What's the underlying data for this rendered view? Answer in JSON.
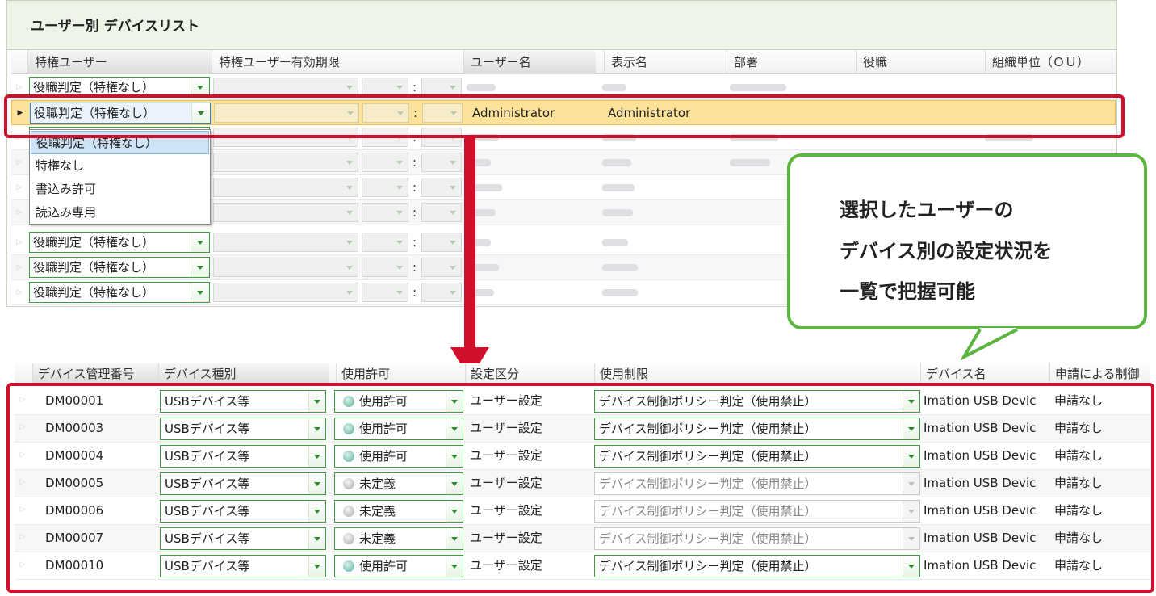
{
  "top_grid": {
    "title": "ユーザー別 デバイスリスト",
    "columns": [
      "特権ユーザー",
      "特権ユーザー有効期限",
      "ユーザー名",
      "表示名",
      "部署",
      "役職",
      "組織単位（ＯＵ）"
    ],
    "combo_value": "役職判定（特権なし）",
    "colon": ":",
    "selected_row": {
      "user_name": "Administrator",
      "display_name": "Administrator"
    },
    "dropdown_options": [
      "役職判定（特権なし）",
      "特権なし",
      "書込み許可",
      "読込み専用"
    ]
  },
  "callout": {
    "lines": [
      "選択したユーザーの",
      "デバイス別の設定状況を",
      "一覧で把握可能"
    ]
  },
  "bottom_grid": {
    "columns": [
      "デバイス管理番号",
      "デバイス種別",
      "使用許可",
      "設定区分",
      "使用制限",
      "デバイス名",
      "申請による制御"
    ],
    "rows": [
      {
        "id": "DM00001",
        "type": "USBデバイス等",
        "permit": "使用許可",
        "permit_on": true,
        "setting": "ユーザー設定",
        "limit": "デバイス制御ポリシー判定（使用禁止）",
        "limit_enabled": true,
        "name": "Imation USB Devic",
        "request": "申請なし"
      },
      {
        "id": "DM00003",
        "type": "USBデバイス等",
        "permit": "使用許可",
        "permit_on": true,
        "setting": "ユーザー設定",
        "limit": "デバイス制御ポリシー判定（使用禁止）",
        "limit_enabled": true,
        "name": "Imation USB Devic",
        "request": "申請なし"
      },
      {
        "id": "DM00004",
        "type": "USBデバイス等",
        "permit": "使用許可",
        "permit_on": true,
        "setting": "ユーザー設定",
        "limit": "デバイス制御ポリシー判定（使用禁止）",
        "limit_enabled": true,
        "name": "Imation USB Devic",
        "request": "申請なし"
      },
      {
        "id": "DM00005",
        "type": "USBデバイス等",
        "permit": "未定義",
        "permit_on": false,
        "setting": "ユーザー設定",
        "limit": "デバイス制御ポリシー判定（使用禁止）",
        "limit_enabled": false,
        "name": "Imation USB Devic",
        "request": "申請なし"
      },
      {
        "id": "DM00006",
        "type": "USBデバイス等",
        "permit": "未定義",
        "permit_on": false,
        "setting": "ユーザー設定",
        "limit": "デバイス制御ポリシー判定（使用禁止）",
        "limit_enabled": false,
        "name": "Imation USB Devic",
        "request": "申請なし"
      },
      {
        "id": "DM00007",
        "type": "USBデバイス等",
        "permit": "未定義",
        "permit_on": false,
        "setting": "ユーザー設定",
        "limit": "デバイス制御ポリシー判定（使用禁止）",
        "limit_enabled": false,
        "name": "Imation USB Devic",
        "request": "申請なし"
      },
      {
        "id": "DM00010",
        "type": "USBデバイス等",
        "permit": "使用許可",
        "permit_on": true,
        "setting": "ユーザー設定",
        "limit": "デバイス制御ポリシー判定（使用禁止）",
        "limit_enabled": true,
        "name": "Imation USB Devic",
        "request": "申請なし"
      }
    ]
  },
  "colors": {
    "highlight_red": "#d0102b",
    "callout_green": "#5cb53f",
    "selected_row": "#fde39a",
    "panel_header": "#eef4e8"
  }
}
